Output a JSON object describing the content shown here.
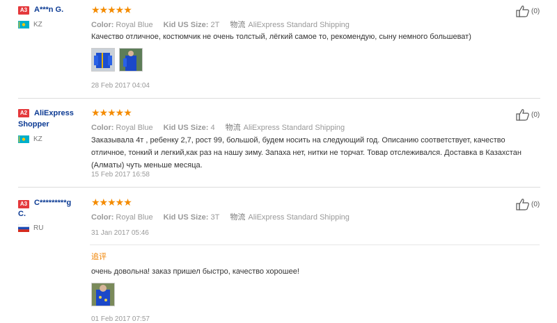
{
  "reviews": [
    {
      "badge": "A3",
      "username": "A***n G.",
      "country": "KZ",
      "flag": "kz",
      "stars": "★★★★★",
      "color_label": "Color:",
      "color_value": "Royal Blue",
      "size_label": "Kid US Size:",
      "size_value": "2T",
      "shipping_icon": "物流",
      "shipping": "AliExpress Standard Shipping",
      "text": "Качество отличное, костюмчик не очень толстый, лёгкий самое то, рекомендую, сыну немного большеват)",
      "date": "28 Feb 2017 04:04",
      "helpful": "(0)"
    },
    {
      "badge": "A2",
      "username": "AliExpress Shopper",
      "country": "KZ",
      "flag": "kz",
      "stars": "★★★★★",
      "color_label": "Color:",
      "color_value": "Royal Blue",
      "size_label": "Kid US Size:",
      "size_value": "4",
      "shipping_icon": "物流",
      "shipping": "AliExpress Standard Shipping",
      "text": "Заказывала 4т , ребенку 2,7, рост 99, большой, будем носить на следующий год. Описанию соответствует, качество отличное, тонкий и легкий,как раз на нашу зиму. Запаха нет, нитки не торчат. Товар отслеживался. Доставка в Казахстан (Алматы) чуть меньше месяца.",
      "date": "15 Feb 2017 16:58",
      "helpful": "(0)"
    },
    {
      "badge": "A3",
      "username": "C*********g C.",
      "country": "RU",
      "flag": "ru",
      "stars": "★★★★★",
      "color_label": "Color:",
      "color_value": "Royal Blue",
      "size_label": "Kid US Size:",
      "size_value": "3T",
      "shipping_icon": "物流",
      "shipping": "AliExpress Standard Shipping",
      "date": "31 Jan 2017 05:46",
      "helpful": "(0)",
      "append_label": "追评",
      "append_text": "очень довольна! заказ пришел быстро, качество хорошее!",
      "append_date": "01 Feb 2017 07:57"
    }
  ],
  "colors": {
    "badge": "#e4393c",
    "username": "#0b3a93",
    "stars": "#f48b00",
    "append": "#f08200"
  }
}
